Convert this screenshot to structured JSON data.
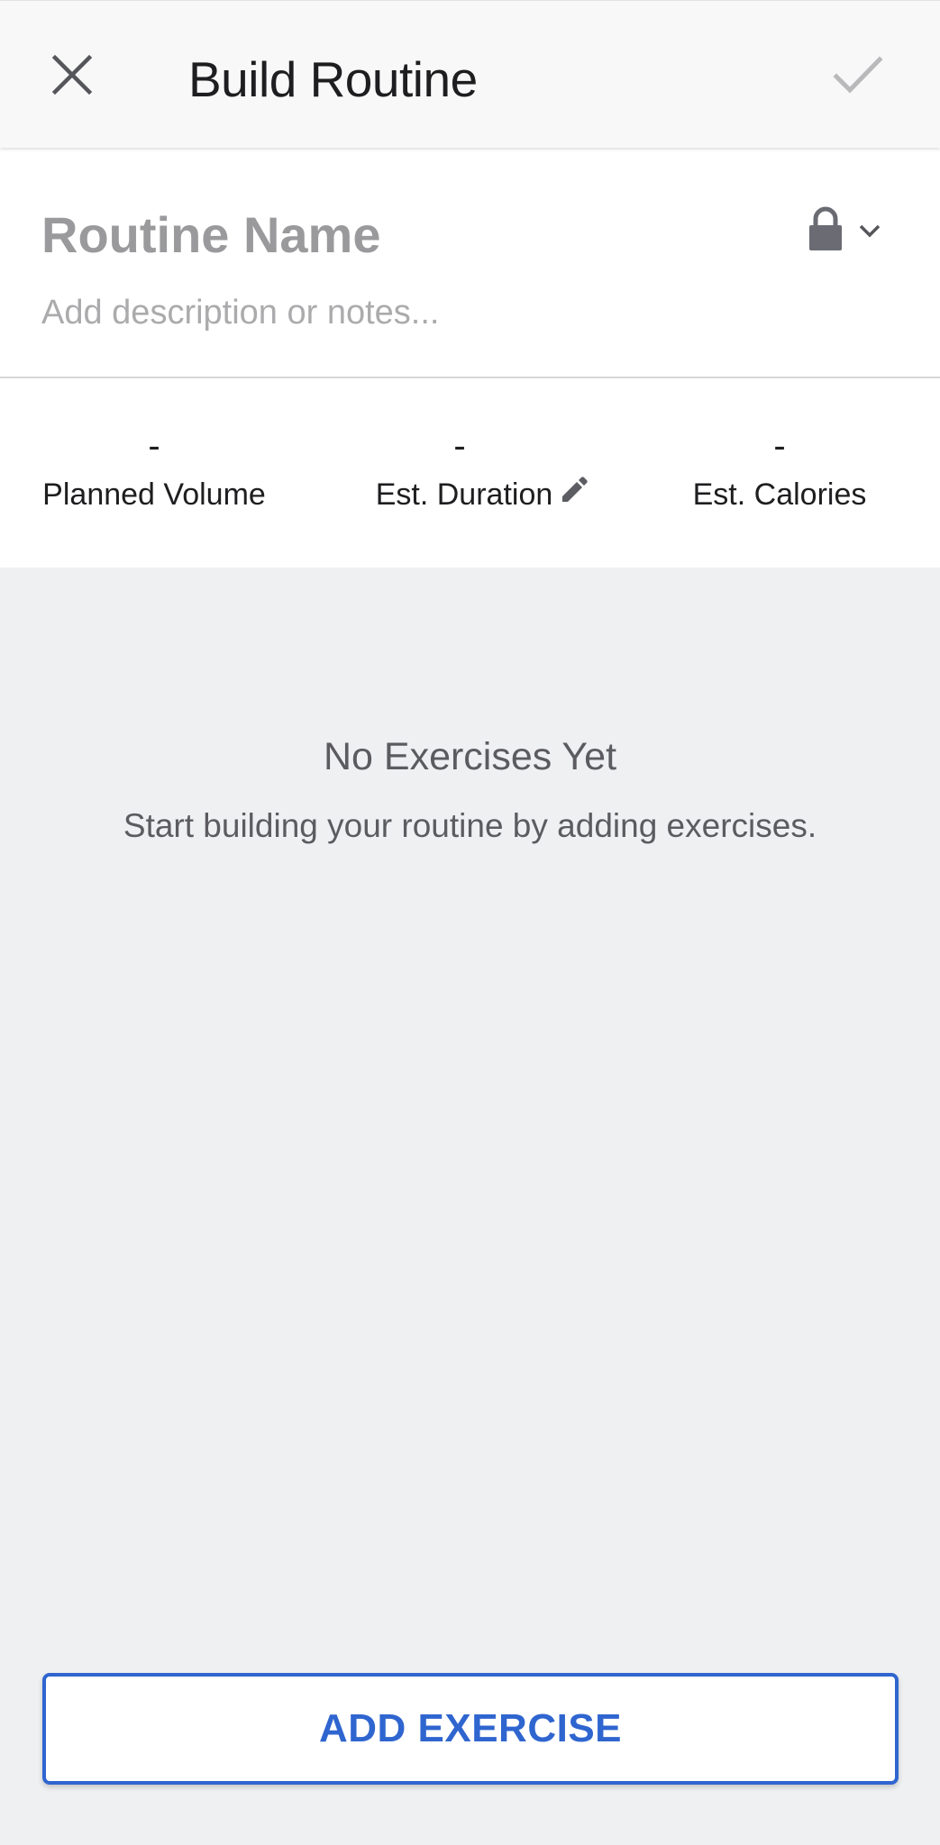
{
  "app_bar": {
    "title": "Build Routine",
    "close_icon": "close-icon",
    "confirm_icon": "checkmark-icon"
  },
  "routine": {
    "name_placeholder": "Routine Name",
    "notes_placeholder": "Add description or notes...",
    "privacy_icon": "lock-icon",
    "privacy_dropdown_icon": "chevron-down-icon"
  },
  "stats": {
    "volume": {
      "value": "-",
      "label": "Planned Volume"
    },
    "duration": {
      "value": "-",
      "label": "Est. Duration",
      "edit_icon": "pencil-icon"
    },
    "calories": {
      "value": "-",
      "label": "Est. Calories"
    }
  },
  "empty_state": {
    "title": "No Exercises Yet",
    "subtitle": "Start building your routine by adding exercises."
  },
  "actions": {
    "add_exercise_label": "ADD EXERCISE"
  },
  "colors": {
    "accent": "#2f65cf",
    "background": "#eff0f2",
    "surface": "#ffffff",
    "app_bar": "#f8f8f8"
  }
}
